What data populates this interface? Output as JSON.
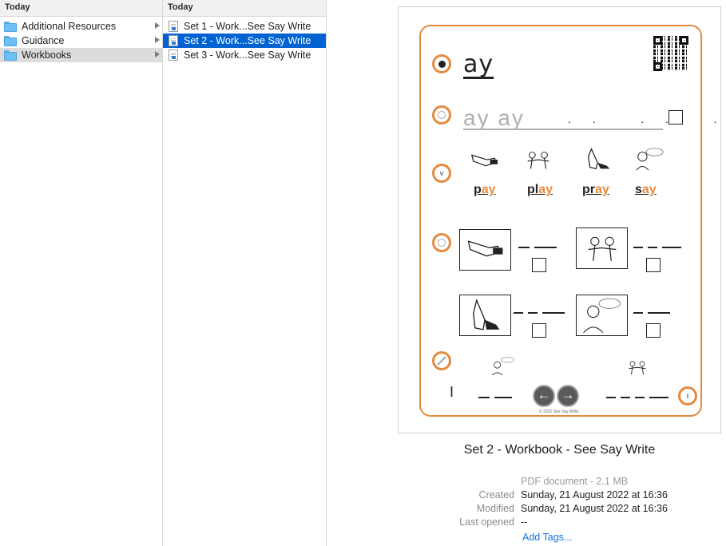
{
  "columns": [
    {
      "header": "Today",
      "items": [
        {
          "label": "Additional Resources",
          "icon": "folder-icon",
          "has_children": true
        },
        {
          "label": "Guidance",
          "icon": "folder-icon",
          "has_children": true
        },
        {
          "label": "Workbooks",
          "icon": "folder-icon",
          "has_children": true,
          "selected": true
        }
      ]
    },
    {
      "header": "Today",
      "items": [
        {
          "label": "Set 1 - Work...See Say Write",
          "icon": "pdf-document-icon"
        },
        {
          "label": "Set 2 - Work...See Say Write",
          "icon": "pdf-document-icon",
          "selected": true
        },
        {
          "label": "Set 3 - Work...See Say Write",
          "icon": "pdf-document-icon"
        }
      ]
    }
  ],
  "preview": {
    "thumbnail": {
      "heading_word": "ay",
      "trace_text": "ay  ay",
      "picture_words": [
        {
          "start": "p",
          "end": "ay"
        },
        {
          "start": "pl",
          "end": "ay"
        },
        {
          "start": "pr",
          "end": "ay"
        },
        {
          "start": "s",
          "end": "ay"
        }
      ],
      "step_icons": [
        "sound-icon",
        "trace-icon",
        "vowel-icon",
        "picture-icon",
        "write-icon"
      ],
      "step_v_label": "v",
      "copyright": "© 2022 See Say Write",
      "accent_color": "#e58a3f"
    },
    "title": "Set 2 - Workbook - See Say Write",
    "kind": "PDF document - 2.1 MB",
    "info": [
      {
        "key": "Created",
        "value": "Sunday, 21 August 2022 at 16:36"
      },
      {
        "key": "Modified",
        "value": "Sunday, 21 August 2022 at 16:36"
      },
      {
        "key": "Last opened",
        "value": "--"
      }
    ],
    "add_tags": "Add Tags..."
  },
  "colors": {
    "selection_blue": "#0063d1",
    "selection_grey": "#dcdcdc",
    "folder_blue": "#6cc0f4",
    "link_blue": "#1a73e0"
  }
}
